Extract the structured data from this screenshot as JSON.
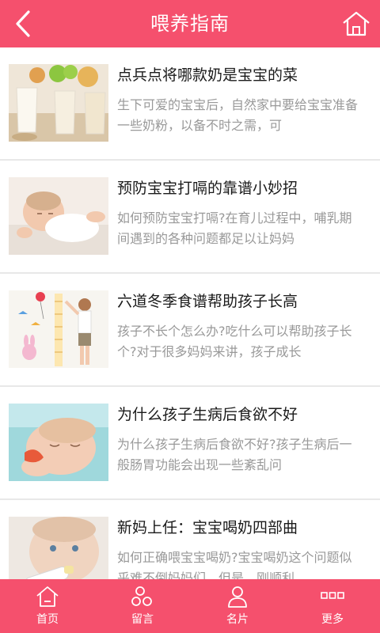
{
  "header": {
    "title": "喂养指南"
  },
  "articles": [
    {
      "title": "点兵点将哪款奶是宝宝的菜",
      "summary": "生下可爱的宝宝后，自然家中要给宝宝准备一些奶粉，以备不时之需，可"
    },
    {
      "title": "预防宝宝打嗝的靠谱小妙招",
      "summary": "如何预防宝宝打嗝?在育儿过程中，哺乳期间遇到的各种问题都足以让妈妈"
    },
    {
      "title": "六道冬季食谱帮助孩子长高",
      "summary": "孩子不长个怎么办?吃什么可以帮助孩子长个?对于很多妈妈来讲，孩子成长"
    },
    {
      "title": "为什么孩子生病后食欲不好",
      "summary": "为什么孩子生病后食欲不好?孩子生病后一般肠胃功能会出现一些紊乱问"
    },
    {
      "title": "新妈上任：宝宝喝奶四部曲",
      "summary": "如何正确喂宝宝喝奶?宝宝喝奶这个问题似乎难不倒妈妈们，但是，刚顺利"
    }
  ],
  "tabs": [
    {
      "label": "首页",
      "icon": "home-icon"
    },
    {
      "label": "留言",
      "icon": "message-icon"
    },
    {
      "label": "名片",
      "icon": "profile-icon"
    },
    {
      "label": "更多",
      "icon": "more-icon"
    }
  ],
  "colors": {
    "accent": "#f5506d",
    "title_text": "#1a1a1a",
    "summary_text": "#999999",
    "divider": "#e8e8e8"
  }
}
